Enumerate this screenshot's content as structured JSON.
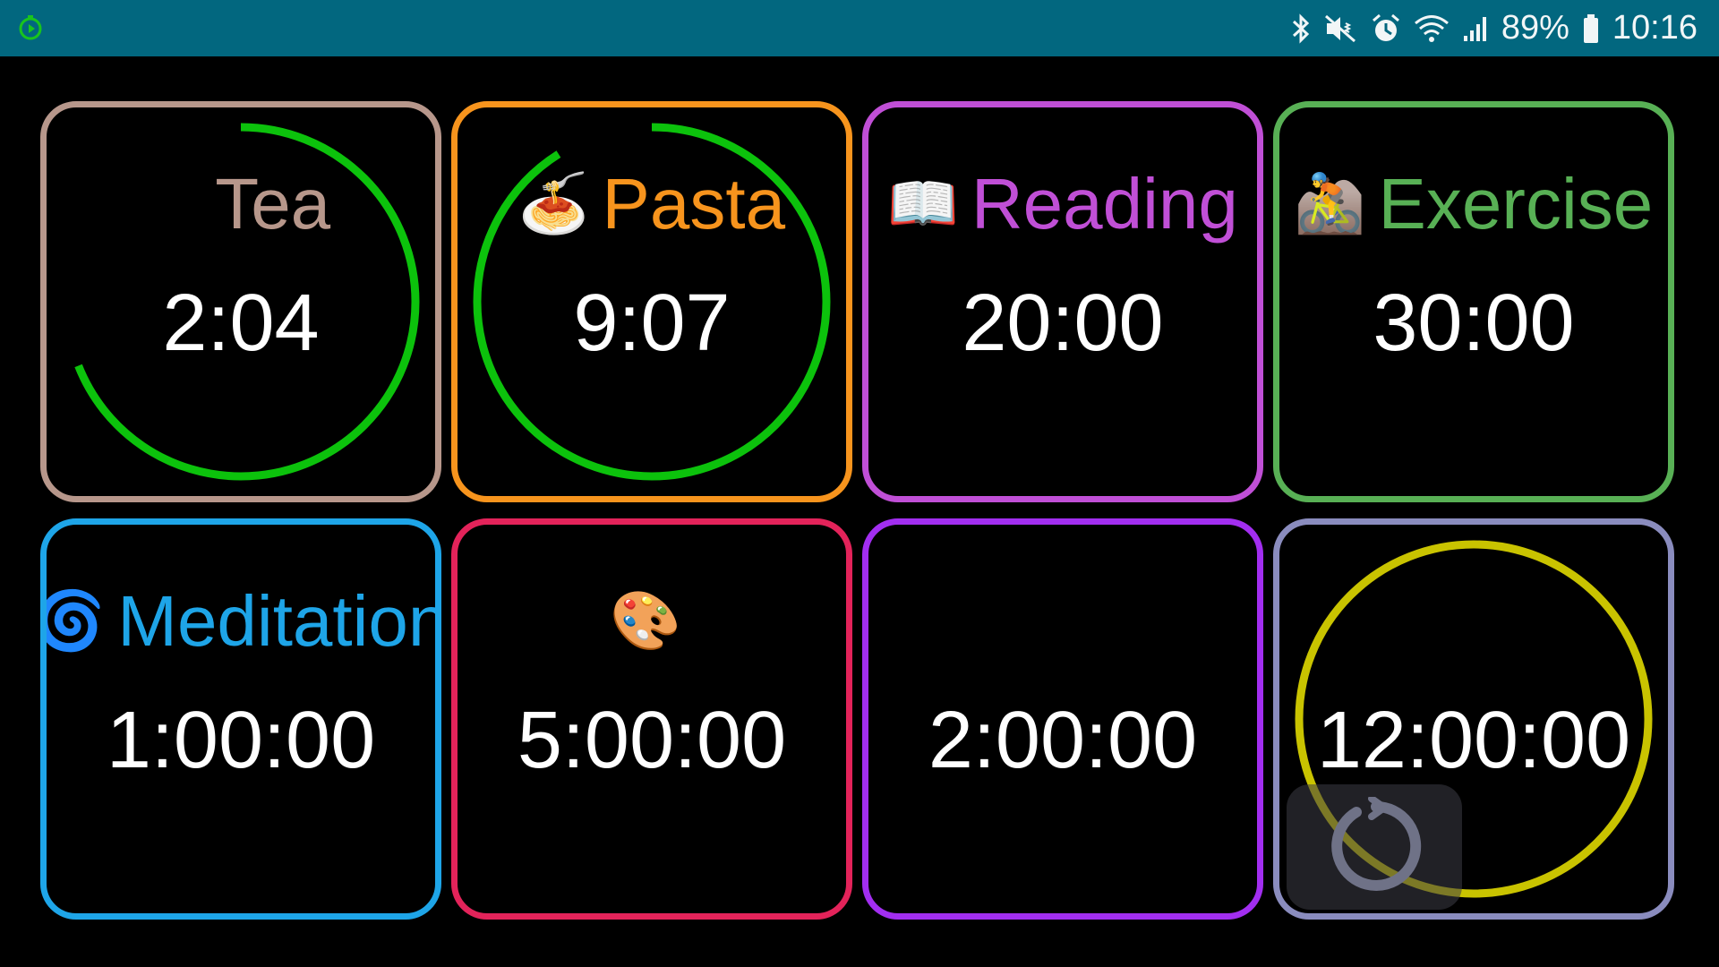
{
  "status_bar": {
    "battery": "89%",
    "time": "10:16",
    "icons": [
      "timer-app-icon",
      "bluetooth-icon",
      "mute-vibrate-icon",
      "alarm-icon",
      "wifi-icon",
      "signal-icon",
      "battery-icon"
    ]
  },
  "timers": [
    {
      "emoji": "☕",
      "label": "Tea",
      "time": "2:04",
      "border_color": "#b7978b",
      "label_color": "#b7978b",
      "progress": 0.69,
      "ring_color": "#0cc20c"
    },
    {
      "emoji": "🍝",
      "label": "Pasta",
      "time": "9:07",
      "border_color": "#f7941d",
      "label_color": "#f7941d",
      "progress": 0.91,
      "ring_color": "#0cc20c"
    },
    {
      "emoji": "📖",
      "label": "Reading",
      "time": "20:00",
      "border_color": "#c04fd6",
      "label_color": "#c04fd6",
      "progress": null,
      "ring_color": null
    },
    {
      "emoji": "🚵",
      "label": "Exercise",
      "time": "30:00",
      "border_color": "#58b055",
      "label_color": "#58b055",
      "progress": null,
      "ring_color": null
    },
    {
      "emoji": "🌀",
      "label": "Meditation",
      "time": "1:00:00",
      "border_color": "#1ea5e8",
      "label_color": "#1ea5e8",
      "progress": null,
      "ring_color": null
    },
    {
      "emoji": "🎨",
      "label": "",
      "time": "5:00:00",
      "border_color": "#e3235a",
      "label_color": "#e3235a",
      "progress": null,
      "ring_color": null
    },
    {
      "emoji": "",
      "label": "",
      "time": "2:00:00",
      "border_color": "#a22ef0",
      "label_color": "#a22ef0",
      "progress": null,
      "ring_color": null
    },
    {
      "emoji": "",
      "label": "",
      "time": "12:00:00",
      "border_color": "#8a8cbe",
      "label_color": "#8a8cbe",
      "progress": 1.0,
      "ring_color": "#c9c300",
      "reset_button": "reset-icon"
    }
  ]
}
